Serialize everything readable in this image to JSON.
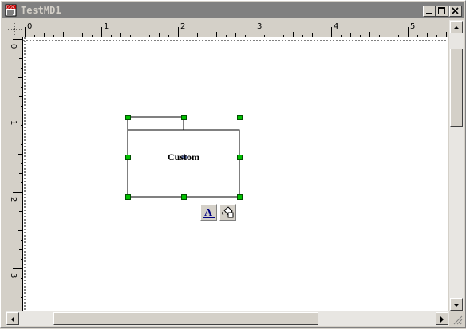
{
  "window": {
    "title": "TestMD1",
    "icon": "doc-file-icon",
    "controls": [
      "minimize-icon",
      "maximize-icon",
      "close-icon"
    ]
  },
  "ruler": {
    "horizontal_labels": [
      "0",
      "1",
      "2",
      "3",
      "4",
      "5"
    ],
    "vertical_labels": [
      "0",
      "1",
      "2",
      "3"
    ]
  },
  "canvas": {
    "shape_text": "Custom",
    "toolbar_icons": [
      "text-format-icon",
      "fill-bucket-icon"
    ]
  },
  "colors": {
    "titlebar_inactive": "#808080",
    "selection_handle": "#00c000"
  }
}
